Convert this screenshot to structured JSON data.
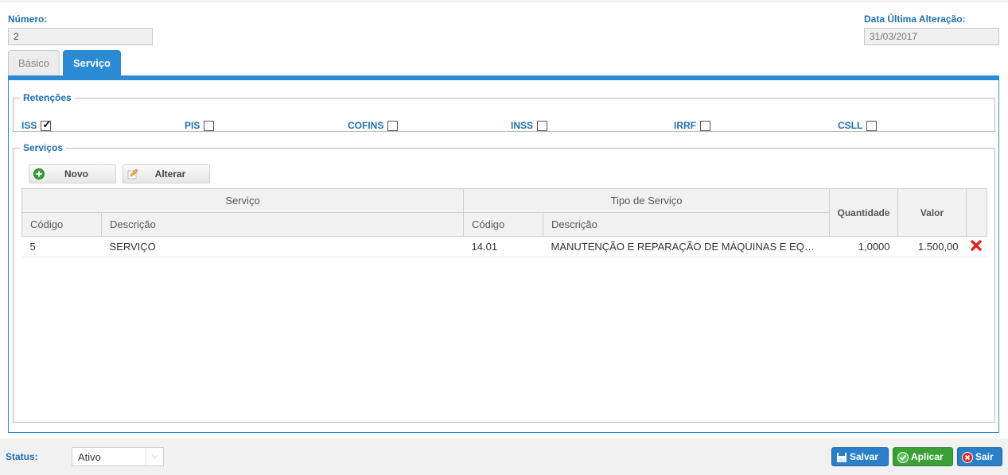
{
  "header": {
    "numero_label": "Número:",
    "numero_value": "2",
    "data_label": "Data Última Alteração:",
    "data_value": "31/03/2017"
  },
  "tabs": [
    {
      "label": "Básico",
      "active": false
    },
    {
      "label": "Serviço",
      "active": true
    }
  ],
  "retencoes": {
    "legend": "Retenções",
    "items": [
      {
        "label": "ISS",
        "checked": true
      },
      {
        "label": "PIS",
        "checked": false
      },
      {
        "label": "COFINS",
        "checked": false
      },
      {
        "label": "INSS",
        "checked": false
      },
      {
        "label": "IRRF",
        "checked": false
      },
      {
        "label": "CSLL",
        "checked": false
      }
    ]
  },
  "servicos": {
    "legend": "Serviços",
    "toolbar": {
      "novo_label": "Novo",
      "alterar_label": "Alterar",
      "novo_icon": "add-circle-icon",
      "alterar_icon": "pencil-icon"
    },
    "table": {
      "group_headers": {
        "servico": "Serviço",
        "tipo": "Tipo de Serviço",
        "quantidade": "Quantidade",
        "valor": "Valor"
      },
      "sub_headers": {
        "codigo1": "Código",
        "descricao1": "Descrição",
        "codigo2": "Código",
        "descricao2": "Descrição"
      },
      "rows": [
        {
          "codigo": "5",
          "descricao": "SERVIÇO",
          "tipo_codigo": "14.01",
          "tipo_descricao": "MANUTENÇÃO E REPARAÇÃO DE MÁQUINAS E EQUIPAMENTOS",
          "quantidade": "1,0000",
          "valor": "1.500,00",
          "action_icon": "delete-x-icon"
        }
      ]
    }
  },
  "footer": {
    "status_label": "Status:",
    "status_value": "Ativo",
    "buttons": {
      "salvar": "Salvar",
      "aplicar": "Aplicar",
      "sair": "Sair"
    }
  },
  "colors": {
    "accent": "#2a8ad4",
    "label": "#1f6fae",
    "green": "#3aa035",
    "delete": "#d9261c"
  }
}
